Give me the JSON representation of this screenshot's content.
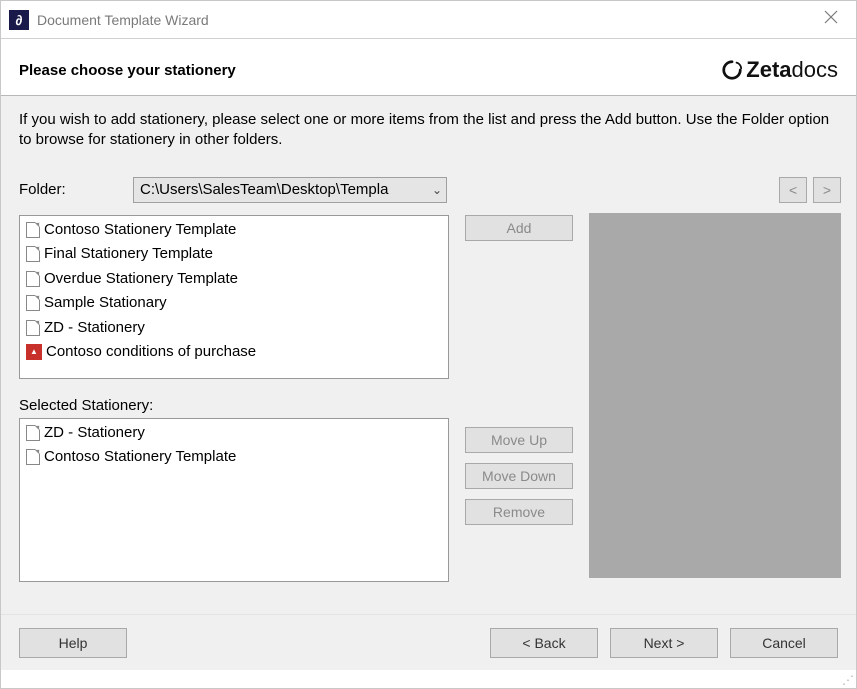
{
  "window": {
    "title": "Document Template Wizard",
    "heading": "Please choose your stationery",
    "brand_name": "Zetadocs",
    "instructions": "If you wish to add stationery, please select one or more items from the list and press the Add button. Use the Folder option to browse for stationery in other folders."
  },
  "folder": {
    "label": "Folder:",
    "value": "C:\\Users\\SalesTeam\\Desktop\\Templa"
  },
  "available": {
    "items": [
      {
        "icon": "doc",
        "name": "Contoso Stationery Template"
      },
      {
        "icon": "doc",
        "name": "Final Stationery Template"
      },
      {
        "icon": "doc",
        "name": "Overdue Stationery Template"
      },
      {
        "icon": "doc",
        "name": "Sample Stationary"
      },
      {
        "icon": "doc",
        "name": "ZD - Stationery"
      },
      {
        "icon": "pdf",
        "name": "Contoso conditions of purchase"
      }
    ]
  },
  "selected": {
    "label": "Selected Stationery:",
    "items": [
      {
        "icon": "doc",
        "name": "ZD - Stationery"
      },
      {
        "icon": "doc",
        "name": "Contoso Stationery Template"
      }
    ]
  },
  "buttons": {
    "add": "Add",
    "move_up": "Move Up",
    "move_down": "Move Down",
    "remove": "Remove",
    "prev_preview": "<",
    "next_preview": ">",
    "help": "Help",
    "back": "< Back",
    "next": "Next >",
    "cancel": "Cancel"
  }
}
